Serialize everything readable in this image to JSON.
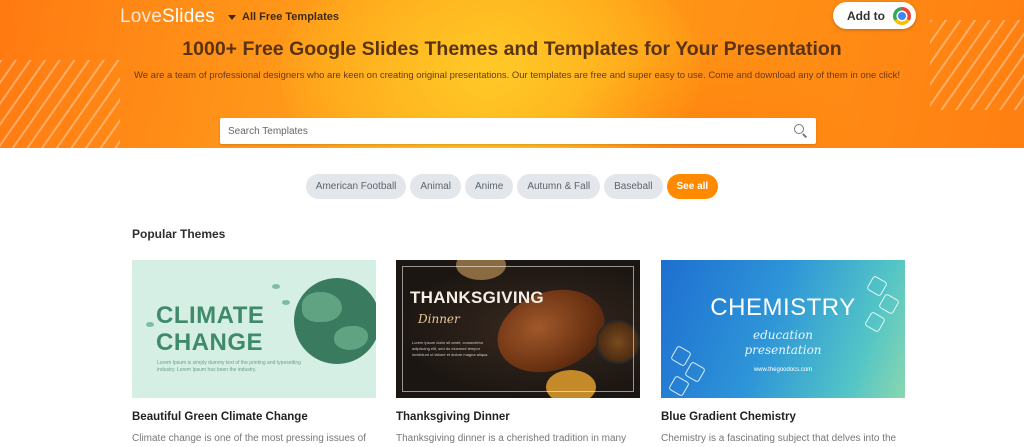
{
  "header": {
    "logo": {
      "love": "Love",
      "slides": "Slides"
    },
    "nav_dropdown_label": "All Free Templates",
    "add_to_label": "Add to",
    "add_to_icon": "chrome-icon"
  },
  "hero": {
    "title": "1000+ Free Google Slides Themes and Templates for Your Presentation",
    "description": "We are a team of professional designers who are keen on creating original presentations. Our templates are free and super easy to use. Come and download any of them in one click!",
    "search": {
      "placeholder": "Search Templates",
      "value": ""
    }
  },
  "tags": [
    {
      "label": "American Football"
    },
    {
      "label": "Animal"
    },
    {
      "label": "Anime"
    },
    {
      "label": "Autumn & Fall"
    },
    {
      "label": "Baseball"
    }
  ],
  "see_all_label": "See all",
  "section": {
    "title": "Popular Themes"
  },
  "cards": [
    {
      "name": "Beautiful Green Climate Change",
      "desc": "Climate change is one of the most pressing issues of",
      "thumb": {
        "line1": "CLIMATE",
        "line2": "CHANGE",
        "small": "Lorem Ipsum is simply dummy text of the printing and typesetting industry. Lorem Ipsum has been the industry.",
        "bg": "#d6efe5",
        "accent": "#3f8a6a"
      }
    },
    {
      "name": "Thanksgiving Dinner",
      "desc": "Thanksgiving dinner is a cherished tradition in many",
      "thumb": {
        "title": "THANKSGIVING",
        "sub": "Dinner",
        "body": "Lorem ipsum dolor sit amet, consectetur adipiscing elit, sed do eiusmod tempor incididunt ut labore et dolore magna aliqua.",
        "bg": "#1c1612"
      }
    },
    {
      "name": "Blue Gradient Chemistry",
      "desc": "Chemistry is a fascinating subject that delves into the",
      "thumb": {
        "title": "CHEMISTRY",
        "line1": "education",
        "line2": "presentation",
        "url": "www.thegoodocs.com",
        "bg": "#1e6fd0"
      }
    }
  ],
  "colors": {
    "hero_orange": "#ff8a1a",
    "see_all_orange": "#ff8a00",
    "tag_bg": "#e3e6ea"
  }
}
